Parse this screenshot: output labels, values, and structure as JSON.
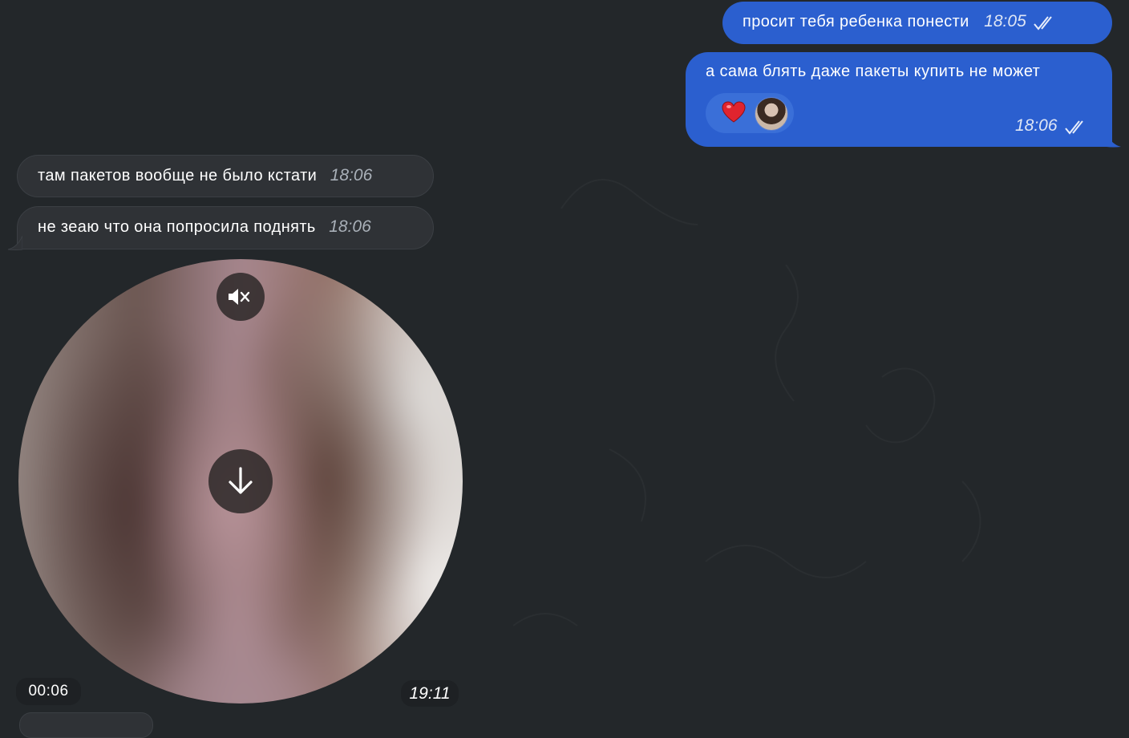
{
  "messages": {
    "out_1": {
      "text": "просит тебя ребенка понести",
      "time": "18:05"
    },
    "out_2": {
      "text": "а сама блять даже пакеты купить не может",
      "time": "18:06",
      "reaction": "heart-emoji"
    },
    "in_1": {
      "text": "там пакетов вообще не было кстати",
      "time": "18:06"
    },
    "in_2": {
      "text": "не зеаю что она попросила поднять",
      "time": "18:06"
    }
  },
  "video_message": {
    "duration": "00:06",
    "time": "19:11",
    "mute_icon": "speaker-muted-icon",
    "download_icon": "download-arrow-icon"
  },
  "colors": {
    "background": "#23272a",
    "outgoing_bubble": "#2b5fcf",
    "incoming_bubble": "#2f3236"
  }
}
